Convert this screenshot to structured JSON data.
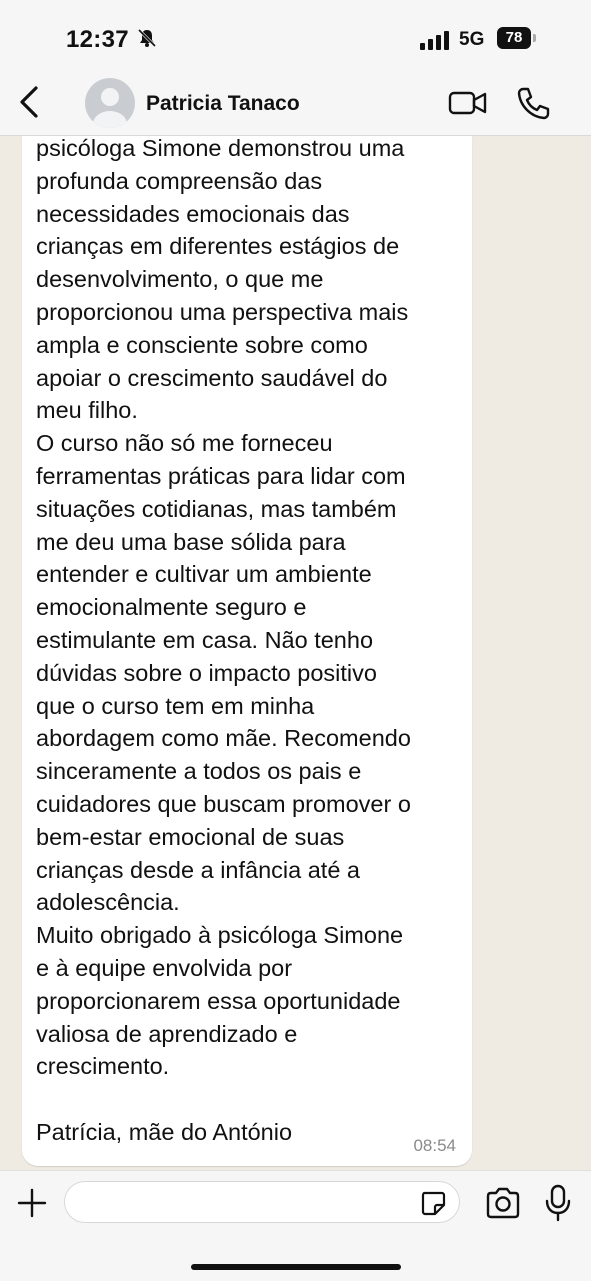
{
  "status_bar": {
    "time": "12:37",
    "network": "5G",
    "battery": "78"
  },
  "header": {
    "contact_name": "Patricia Tanaco"
  },
  "message": {
    "text": "psicóloga Simone demonstrou uma\nprofunda compreensão das\nnecessidades emocionais das\ncrianças em diferentes estágios de\ndesenvolvimento, o que me\nproporcionou uma perspectiva mais\nampla e consciente sobre como\napoiar o crescimento saudável do\nmeu filho.\nO curso não só me forneceu\nferramentas práticas para lidar com\nsituações cotidianas, mas também\nme deu uma base sólida para\nentender e cultivar um ambiente\nemocionalmente seguro e\nestimulante em casa. Não tenho\ndúvidas sobre o impacto positivo\nque o curso tem em minha\nabordagem como mãe. Recomendo\nsinceramente a todos os pais e\ncuidadores que buscam promover o\nbem-estar emocional de suas\ncrianças desde a infância até a\nadolescência.\nMuito obrigado à psicóloga Simone\ne à equipe envolvida por\nproporcionarem essa oportunidade\nvaliosa de aprendizado e\ncrescimento.\n\nPatrícia, mãe do António",
    "time": "08:54"
  },
  "composer": {
    "value": ""
  },
  "icons": [
    "bell-slash-icon",
    "signal-icon",
    "back-icon",
    "avatar-icon",
    "video-icon",
    "phone-icon",
    "plus-icon",
    "sticker-icon",
    "camera-icon",
    "mic-icon"
  ],
  "colors": {
    "chat_background": "#efeae2",
    "bubble": "#ffffff",
    "bar": "#f6f6f6",
    "timestamp": "#8a8a8a"
  }
}
